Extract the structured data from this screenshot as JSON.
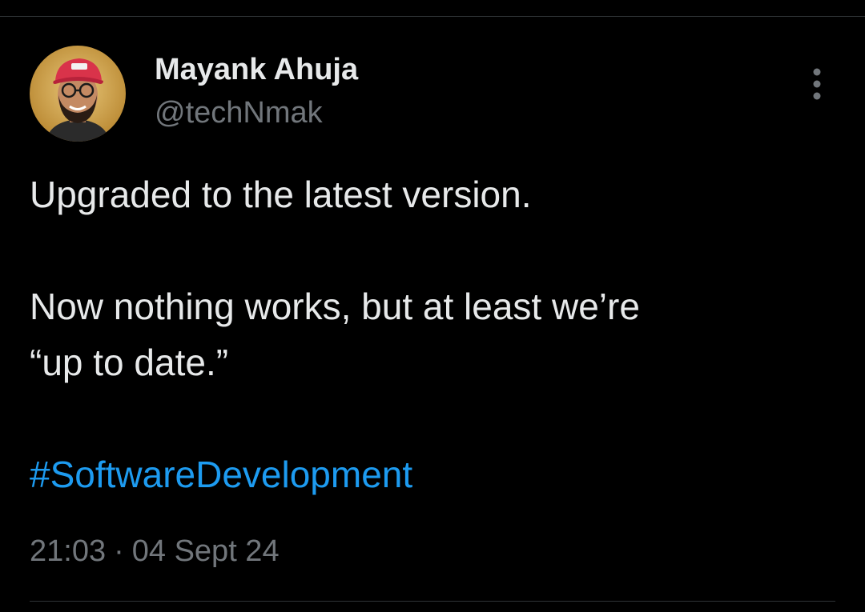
{
  "author": {
    "name": "Mayank Ahuja",
    "handle": "@techNmak",
    "avatar_icon": "user-avatar-photo"
  },
  "tweet": {
    "line1": "Upgraded to the latest version.",
    "line2": "Now nothing works, but at least we’re",
    "line3": "“up to date.”",
    "hashtag": "#SoftwareDevelopment"
  },
  "meta": {
    "time": "21:03",
    "separator": "·",
    "date": "04 Sept 24"
  },
  "icons": {
    "more": "more-vertical-icon"
  },
  "colors": {
    "background": "#000000",
    "text": "#e7e9ea",
    "secondary_text": "#71767b",
    "link": "#1d9bf0",
    "divider": "#2f3336"
  }
}
